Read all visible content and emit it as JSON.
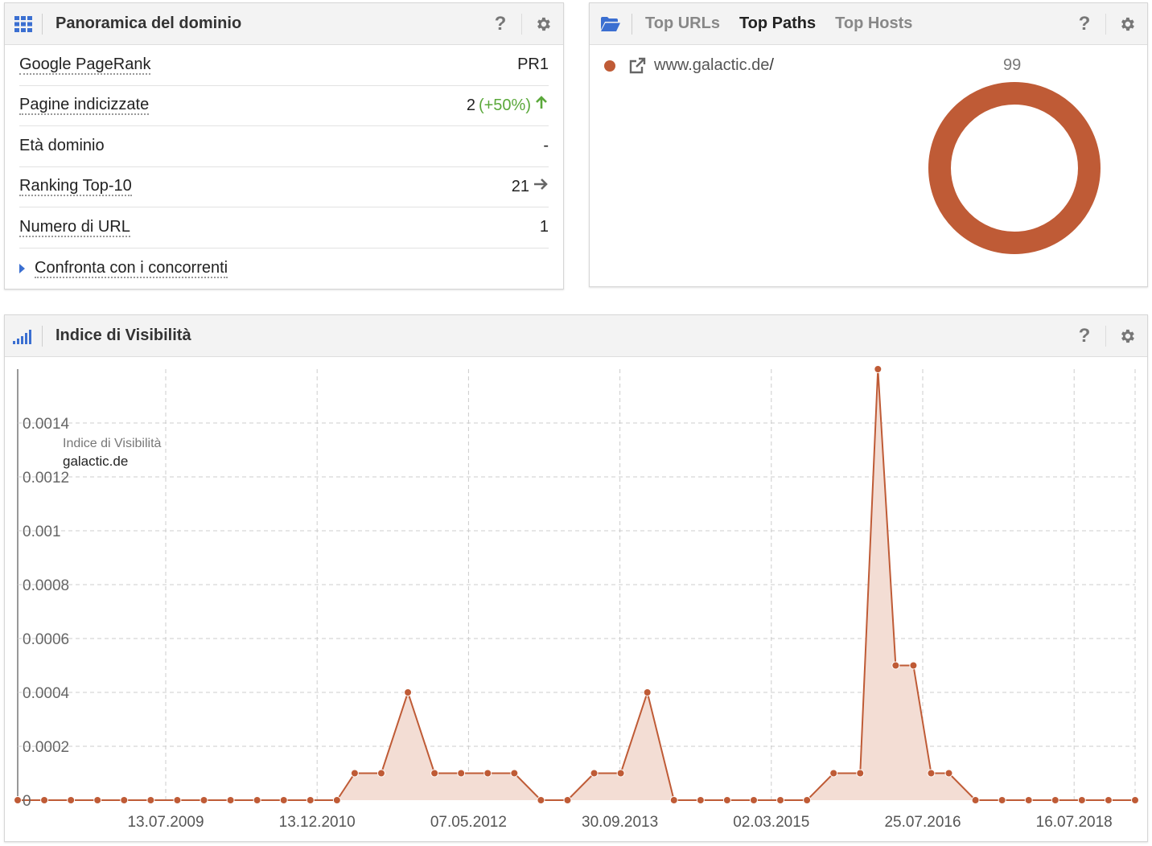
{
  "overview": {
    "title": "Panoramica del dominio",
    "help": "?",
    "rows": [
      {
        "label": "Google PageRank",
        "value": "PR1",
        "trend": "",
        "arrow": ""
      },
      {
        "label": "Pagine indicizzate",
        "value": "2",
        "trend": "(+50%)",
        "arrow": "up-arrow-icon"
      },
      {
        "label": "Età dominio",
        "value": "-",
        "trend": "",
        "arrow": ""
      },
      {
        "label": "Ranking Top-10",
        "value": "21",
        "trend": "",
        "arrow": "right-arrow-icon"
      },
      {
        "label": "Numero di URL",
        "value": "1",
        "trend": "",
        "arrow": ""
      }
    ],
    "compare_label": "Confronta con i concorrenti"
  },
  "paths": {
    "tabs": [
      "Top URLs",
      "Top Paths",
      "Top Hosts"
    ],
    "active_tab": "Top Paths",
    "help": "?",
    "items": [
      {
        "domain": "www.galactic.de",
        "path": "/",
        "value": "99",
        "color": "#bf5b36"
      }
    ]
  },
  "visibility": {
    "title": "Indice di Visibilità",
    "help": "?",
    "legend_title": "Indice di Visibilità",
    "legend_series": "galactic.de"
  },
  "colors": {
    "accent": "#bf5b36",
    "fill": "#f3ddd4",
    "icon_blue": "#3b6fd1",
    "positive": "#5aa83a"
  },
  "chart_data": {
    "type": "area",
    "title": "",
    "ylabel": "",
    "xlabel": "",
    "yticks": [
      "0",
      "0.0002",
      "0.0004",
      "0.0006",
      "0.0008",
      "0.001",
      "0.0012",
      "0.0014"
    ],
    "ylim": [
      0,
      0.0016
    ],
    "x_tick_labels": [
      "13.07.2009",
      "13.12.2010",
      "07.05.2012",
      "30.09.2013",
      "02.03.2015",
      "25.07.2016",
      "16.07.2018"
    ],
    "grid": true,
    "series": [
      {
        "name": "galactic.de",
        "x": [
          "2008-01",
          "2008-04",
          "2008-07",
          "2008-10",
          "2009-01",
          "2009-04",
          "2009-07",
          "2009-10",
          "2010-01",
          "2010-04",
          "2010-07",
          "2010-10",
          "2011-01",
          "2011-03",
          "2011-06",
          "2011-09",
          "2011-12",
          "2012-03",
          "2012-06",
          "2012-09",
          "2012-12",
          "2013-03",
          "2013-06",
          "2013-09",
          "2013-12",
          "2014-03",
          "2014-06",
          "2014-09",
          "2014-12",
          "2015-03",
          "2015-06",
          "2015-09",
          "2015-12",
          "2016-02",
          "2016-04",
          "2016-06",
          "2016-08",
          "2016-10",
          "2017-01",
          "2017-04",
          "2017-07",
          "2017-10",
          "2018-01",
          "2018-04",
          "2018-07"
        ],
        "values": [
          0,
          0,
          0,
          0,
          0,
          0,
          0,
          0,
          0,
          0,
          0,
          0,
          0,
          0.0001,
          0.0001,
          0.0004,
          0.0001,
          0.0001,
          0.0001,
          0.0001,
          0,
          0,
          0.0001,
          0.0001,
          0.0004,
          0,
          0,
          0,
          0,
          0,
          0,
          0.0001,
          0.0001,
          0.0016,
          0.0005,
          0.0005,
          0.0001,
          0.0001,
          0,
          0,
          0,
          0,
          0,
          0,
          0
        ]
      }
    ]
  }
}
